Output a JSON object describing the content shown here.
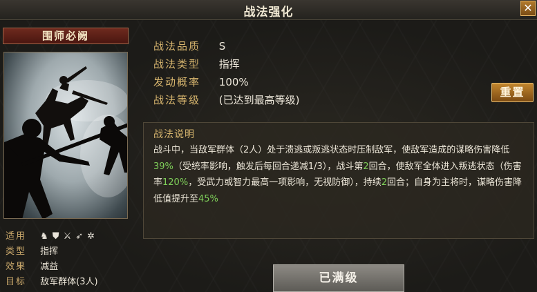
{
  "header": {
    "title": "战法强化",
    "close_icon": "close-icon"
  },
  "card": {
    "name": "围师必阙",
    "meta": [
      {
        "key": "适用",
        "icons": [
          "cavalry-icon",
          "shield-icon",
          "crossed-swords-icon",
          "spear-icon",
          "siege-icon"
        ]
      },
      {
        "key": "类型",
        "value": "指挥"
      },
      {
        "key": "效果",
        "value": "减益"
      },
      {
        "key": "目标",
        "value": "敌军群体(3人)"
      }
    ]
  },
  "stats": [
    {
      "key": "战法品质",
      "value": "S"
    },
    {
      "key": "战法类型",
      "value": "指挥"
    },
    {
      "key": "发动概率",
      "value": "100%"
    },
    {
      "key": "战法等级",
      "value": "(已达到最高等级)"
    }
  ],
  "reset_label": "重置",
  "description": {
    "heading": "战法说明",
    "segments": [
      {
        "text": "战斗中，当敌军群体（2人）处于溃逃或叛逃状态时压制敌军，使敌军造成的谋略伤害降低",
        "color": "normal"
      },
      {
        "text": "39%",
        "color": "green"
      },
      {
        "text": "（受统率影响，触发后每回合递减1/3），战斗第",
        "color": "normal"
      },
      {
        "text": "2",
        "color": "green"
      },
      {
        "text": "回合，使敌军全体进入叛逃状态（伤害率",
        "color": "normal"
      },
      {
        "text": "120%",
        "color": "green"
      },
      {
        "text": "，受武力或智力最高一项影响，无视防御），持续",
        "color": "normal"
      },
      {
        "text": "2",
        "color": "green"
      },
      {
        "text": "回合；自身为主将时，谋略伤害降低值提升至",
        "color": "normal"
      },
      {
        "text": "45%",
        "color": "green"
      }
    ],
    "highlight_color": "#7fd05a"
  },
  "maxed_label": "已满级"
}
